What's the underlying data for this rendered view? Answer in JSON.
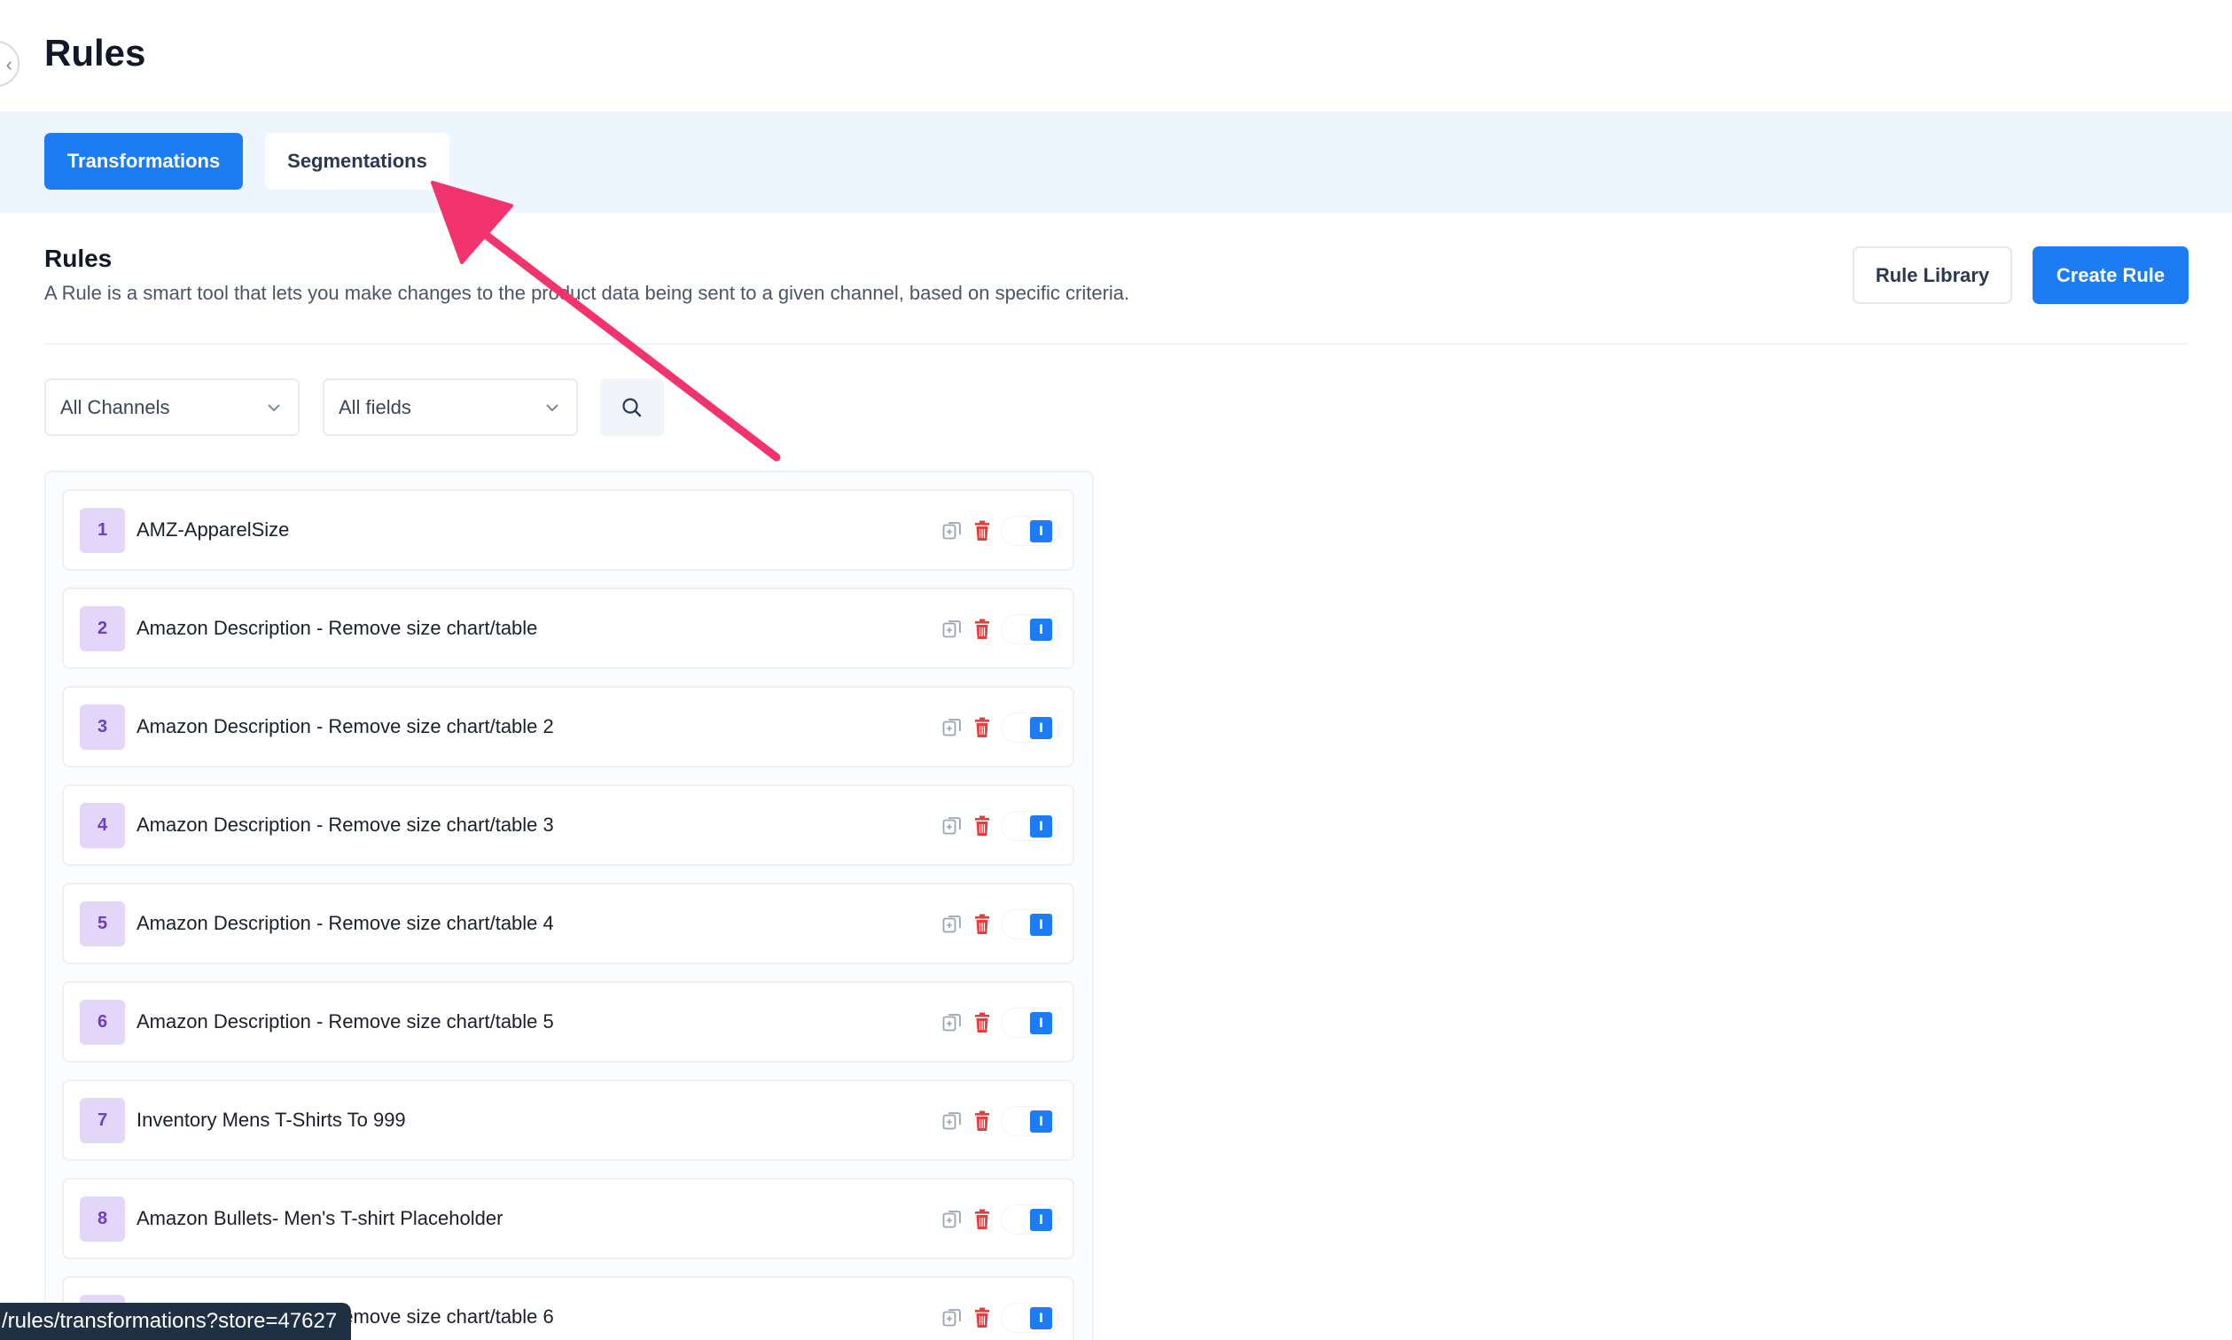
{
  "page": {
    "title": "Rules"
  },
  "tabs": [
    {
      "label": "Transformations",
      "active": true
    },
    {
      "label": "Segmentations",
      "active": false
    }
  ],
  "section": {
    "title": "Rules",
    "description": "A Rule is a smart tool that lets you make changes to the product data being sent to a given channel, based on specific criteria."
  },
  "actions": {
    "rule_library": "Rule Library",
    "create_rule": "Create Rule"
  },
  "filters": {
    "channels": "All Channels",
    "fields": "All fields",
    "search_icon": "search-icon"
  },
  "rules": [
    {
      "num": "1",
      "name": "AMZ-ApparelSize",
      "enabled": true
    },
    {
      "num": "2",
      "name": "Amazon Description - Remove size chart/table",
      "enabled": true
    },
    {
      "num": "3",
      "name": "Amazon Description - Remove size chart/table 2",
      "enabled": true
    },
    {
      "num": "4",
      "name": "Amazon Description - Remove size chart/table 3",
      "enabled": true
    },
    {
      "num": "5",
      "name": "Amazon Description - Remove size chart/table 4",
      "enabled": true
    },
    {
      "num": "6",
      "name": "Amazon Description - Remove size chart/table 5",
      "enabled": true
    },
    {
      "num": "7",
      "name": "Inventory Mens T-Shirts To 999",
      "enabled": true
    },
    {
      "num": "8",
      "name": "Amazon Bullets- Men's T-shirt Placeholder",
      "enabled": true
    },
    {
      "num": "9",
      "name": "Amazon Description - Remove size chart/table 6",
      "enabled": true
    }
  ],
  "toggle_glyph": "I",
  "status_bar": {
    "url": "/rules/transformations?store=47627"
  },
  "colors": {
    "accent": "#1d7bf4",
    "tabs_band": "#edf5fe",
    "badge_bg": "#e4d6f8",
    "badge_text": "#6b3fc4",
    "delete": "#e53e3e",
    "annotation": "#f2336d"
  }
}
